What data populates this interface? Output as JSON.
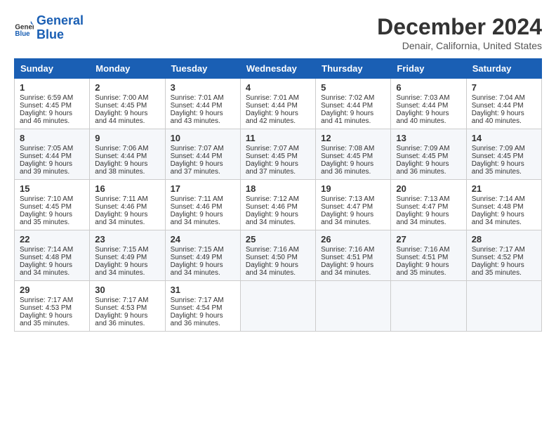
{
  "header": {
    "logo_line1": "General",
    "logo_line2": "Blue",
    "month_title": "December 2024",
    "location": "Denair, California, United States"
  },
  "days_of_week": [
    "Sunday",
    "Monday",
    "Tuesday",
    "Wednesday",
    "Thursday",
    "Friday",
    "Saturday"
  ],
  "weeks": [
    [
      {
        "day": "1",
        "sunrise": "6:59 AM",
        "sunset": "4:45 PM",
        "daylight": "9 hours and 46 minutes."
      },
      {
        "day": "2",
        "sunrise": "7:00 AM",
        "sunset": "4:45 PM",
        "daylight": "9 hours and 44 minutes."
      },
      {
        "day": "3",
        "sunrise": "7:01 AM",
        "sunset": "4:44 PM",
        "daylight": "9 hours and 43 minutes."
      },
      {
        "day": "4",
        "sunrise": "7:01 AM",
        "sunset": "4:44 PM",
        "daylight": "9 hours and 42 minutes."
      },
      {
        "day": "5",
        "sunrise": "7:02 AM",
        "sunset": "4:44 PM",
        "daylight": "9 hours and 41 minutes."
      },
      {
        "day": "6",
        "sunrise": "7:03 AM",
        "sunset": "4:44 PM",
        "daylight": "9 hours and 40 minutes."
      },
      {
        "day": "7",
        "sunrise": "7:04 AM",
        "sunset": "4:44 PM",
        "daylight": "9 hours and 40 minutes."
      }
    ],
    [
      {
        "day": "8",
        "sunrise": "7:05 AM",
        "sunset": "4:44 PM",
        "daylight": "9 hours and 39 minutes."
      },
      {
        "day": "9",
        "sunrise": "7:06 AM",
        "sunset": "4:44 PM",
        "daylight": "9 hours and 38 minutes."
      },
      {
        "day": "10",
        "sunrise": "7:07 AM",
        "sunset": "4:44 PM",
        "daylight": "9 hours and 37 minutes."
      },
      {
        "day": "11",
        "sunrise": "7:07 AM",
        "sunset": "4:45 PM",
        "daylight": "9 hours and 37 minutes."
      },
      {
        "day": "12",
        "sunrise": "7:08 AM",
        "sunset": "4:45 PM",
        "daylight": "9 hours and 36 minutes."
      },
      {
        "day": "13",
        "sunrise": "7:09 AM",
        "sunset": "4:45 PM",
        "daylight": "9 hours and 36 minutes."
      },
      {
        "day": "14",
        "sunrise": "7:09 AM",
        "sunset": "4:45 PM",
        "daylight": "9 hours and 35 minutes."
      }
    ],
    [
      {
        "day": "15",
        "sunrise": "7:10 AM",
        "sunset": "4:45 PM",
        "daylight": "9 hours and 35 minutes."
      },
      {
        "day": "16",
        "sunrise": "7:11 AM",
        "sunset": "4:46 PM",
        "daylight": "9 hours and 34 minutes."
      },
      {
        "day": "17",
        "sunrise": "7:11 AM",
        "sunset": "4:46 PM",
        "daylight": "9 hours and 34 minutes."
      },
      {
        "day": "18",
        "sunrise": "7:12 AM",
        "sunset": "4:46 PM",
        "daylight": "9 hours and 34 minutes."
      },
      {
        "day": "19",
        "sunrise": "7:13 AM",
        "sunset": "4:47 PM",
        "daylight": "9 hours and 34 minutes."
      },
      {
        "day": "20",
        "sunrise": "7:13 AM",
        "sunset": "4:47 PM",
        "daylight": "9 hours and 34 minutes."
      },
      {
        "day": "21",
        "sunrise": "7:14 AM",
        "sunset": "4:48 PM",
        "daylight": "9 hours and 34 minutes."
      }
    ],
    [
      {
        "day": "22",
        "sunrise": "7:14 AM",
        "sunset": "4:48 PM",
        "daylight": "9 hours and 34 minutes."
      },
      {
        "day": "23",
        "sunrise": "7:15 AM",
        "sunset": "4:49 PM",
        "daylight": "9 hours and 34 minutes."
      },
      {
        "day": "24",
        "sunrise": "7:15 AM",
        "sunset": "4:49 PM",
        "daylight": "9 hours and 34 minutes."
      },
      {
        "day": "25",
        "sunrise": "7:16 AM",
        "sunset": "4:50 PM",
        "daylight": "9 hours and 34 minutes."
      },
      {
        "day": "26",
        "sunrise": "7:16 AM",
        "sunset": "4:51 PM",
        "daylight": "9 hours and 34 minutes."
      },
      {
        "day": "27",
        "sunrise": "7:16 AM",
        "sunset": "4:51 PM",
        "daylight": "9 hours and 35 minutes."
      },
      {
        "day": "28",
        "sunrise": "7:17 AM",
        "sunset": "4:52 PM",
        "daylight": "9 hours and 35 minutes."
      }
    ],
    [
      {
        "day": "29",
        "sunrise": "7:17 AM",
        "sunset": "4:53 PM",
        "daylight": "9 hours and 35 minutes."
      },
      {
        "day": "30",
        "sunrise": "7:17 AM",
        "sunset": "4:53 PM",
        "daylight": "9 hours and 36 minutes."
      },
      {
        "day": "31",
        "sunrise": "7:17 AM",
        "sunset": "4:54 PM",
        "daylight": "9 hours and 36 minutes."
      },
      null,
      null,
      null,
      null
    ]
  ]
}
